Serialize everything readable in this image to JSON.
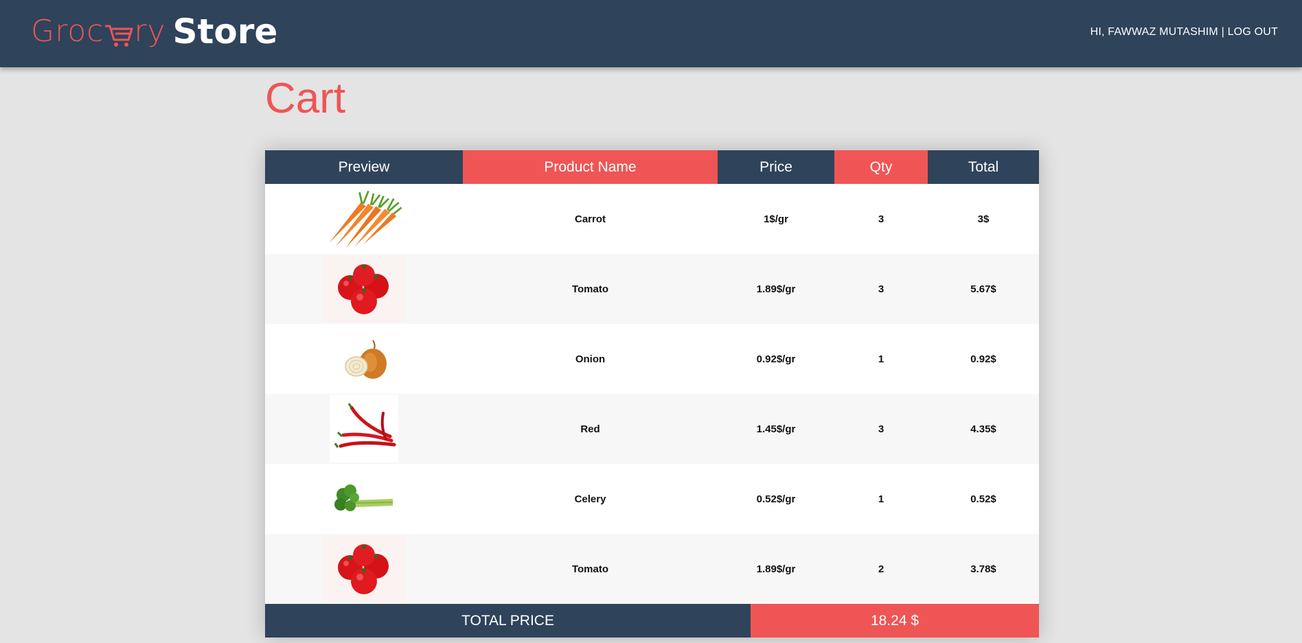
{
  "header": {
    "logo_part1": "Groc",
    "logo_part2": "ry",
    "logo_part3": "Store",
    "greeting": "HI, FAWWAZ MUTASHIM",
    "separator": "|",
    "logout_label": "LOG OUT"
  },
  "page": {
    "title": "Cart"
  },
  "table": {
    "headers": [
      "Preview",
      "Product Name",
      "Price",
      "Qty",
      "Total"
    ],
    "rows": [
      {
        "image": "carrot-image",
        "name": "Carrot",
        "price": "1$/gr",
        "qty": "3",
        "total": "3$"
      },
      {
        "image": "tomato-image",
        "name": "Tomato",
        "price": "1.89$/gr",
        "qty": "3",
        "total": "5.67$"
      },
      {
        "image": "onion-image",
        "name": "Onion",
        "price": "0.92$/gr",
        "qty": "1",
        "total": "0.92$"
      },
      {
        "image": "red-pepper-image",
        "name": "Red",
        "price": "1.45$/gr",
        "qty": "3",
        "total": "4.35$"
      },
      {
        "image": "celery-image",
        "name": "Celery",
        "price": "0.52$/gr",
        "qty": "1",
        "total": "0.52$"
      },
      {
        "image": "tomato-image",
        "name": "Tomato",
        "price": "1.89$/gr",
        "qty": "2",
        "total": "3.78$"
      }
    ],
    "total_label": "TOTAL PRICE",
    "total_value": "18.24 $"
  },
  "colors": {
    "navy": "#2f435b",
    "accent_red": "#ef5555",
    "background": "#e4e4e4"
  }
}
